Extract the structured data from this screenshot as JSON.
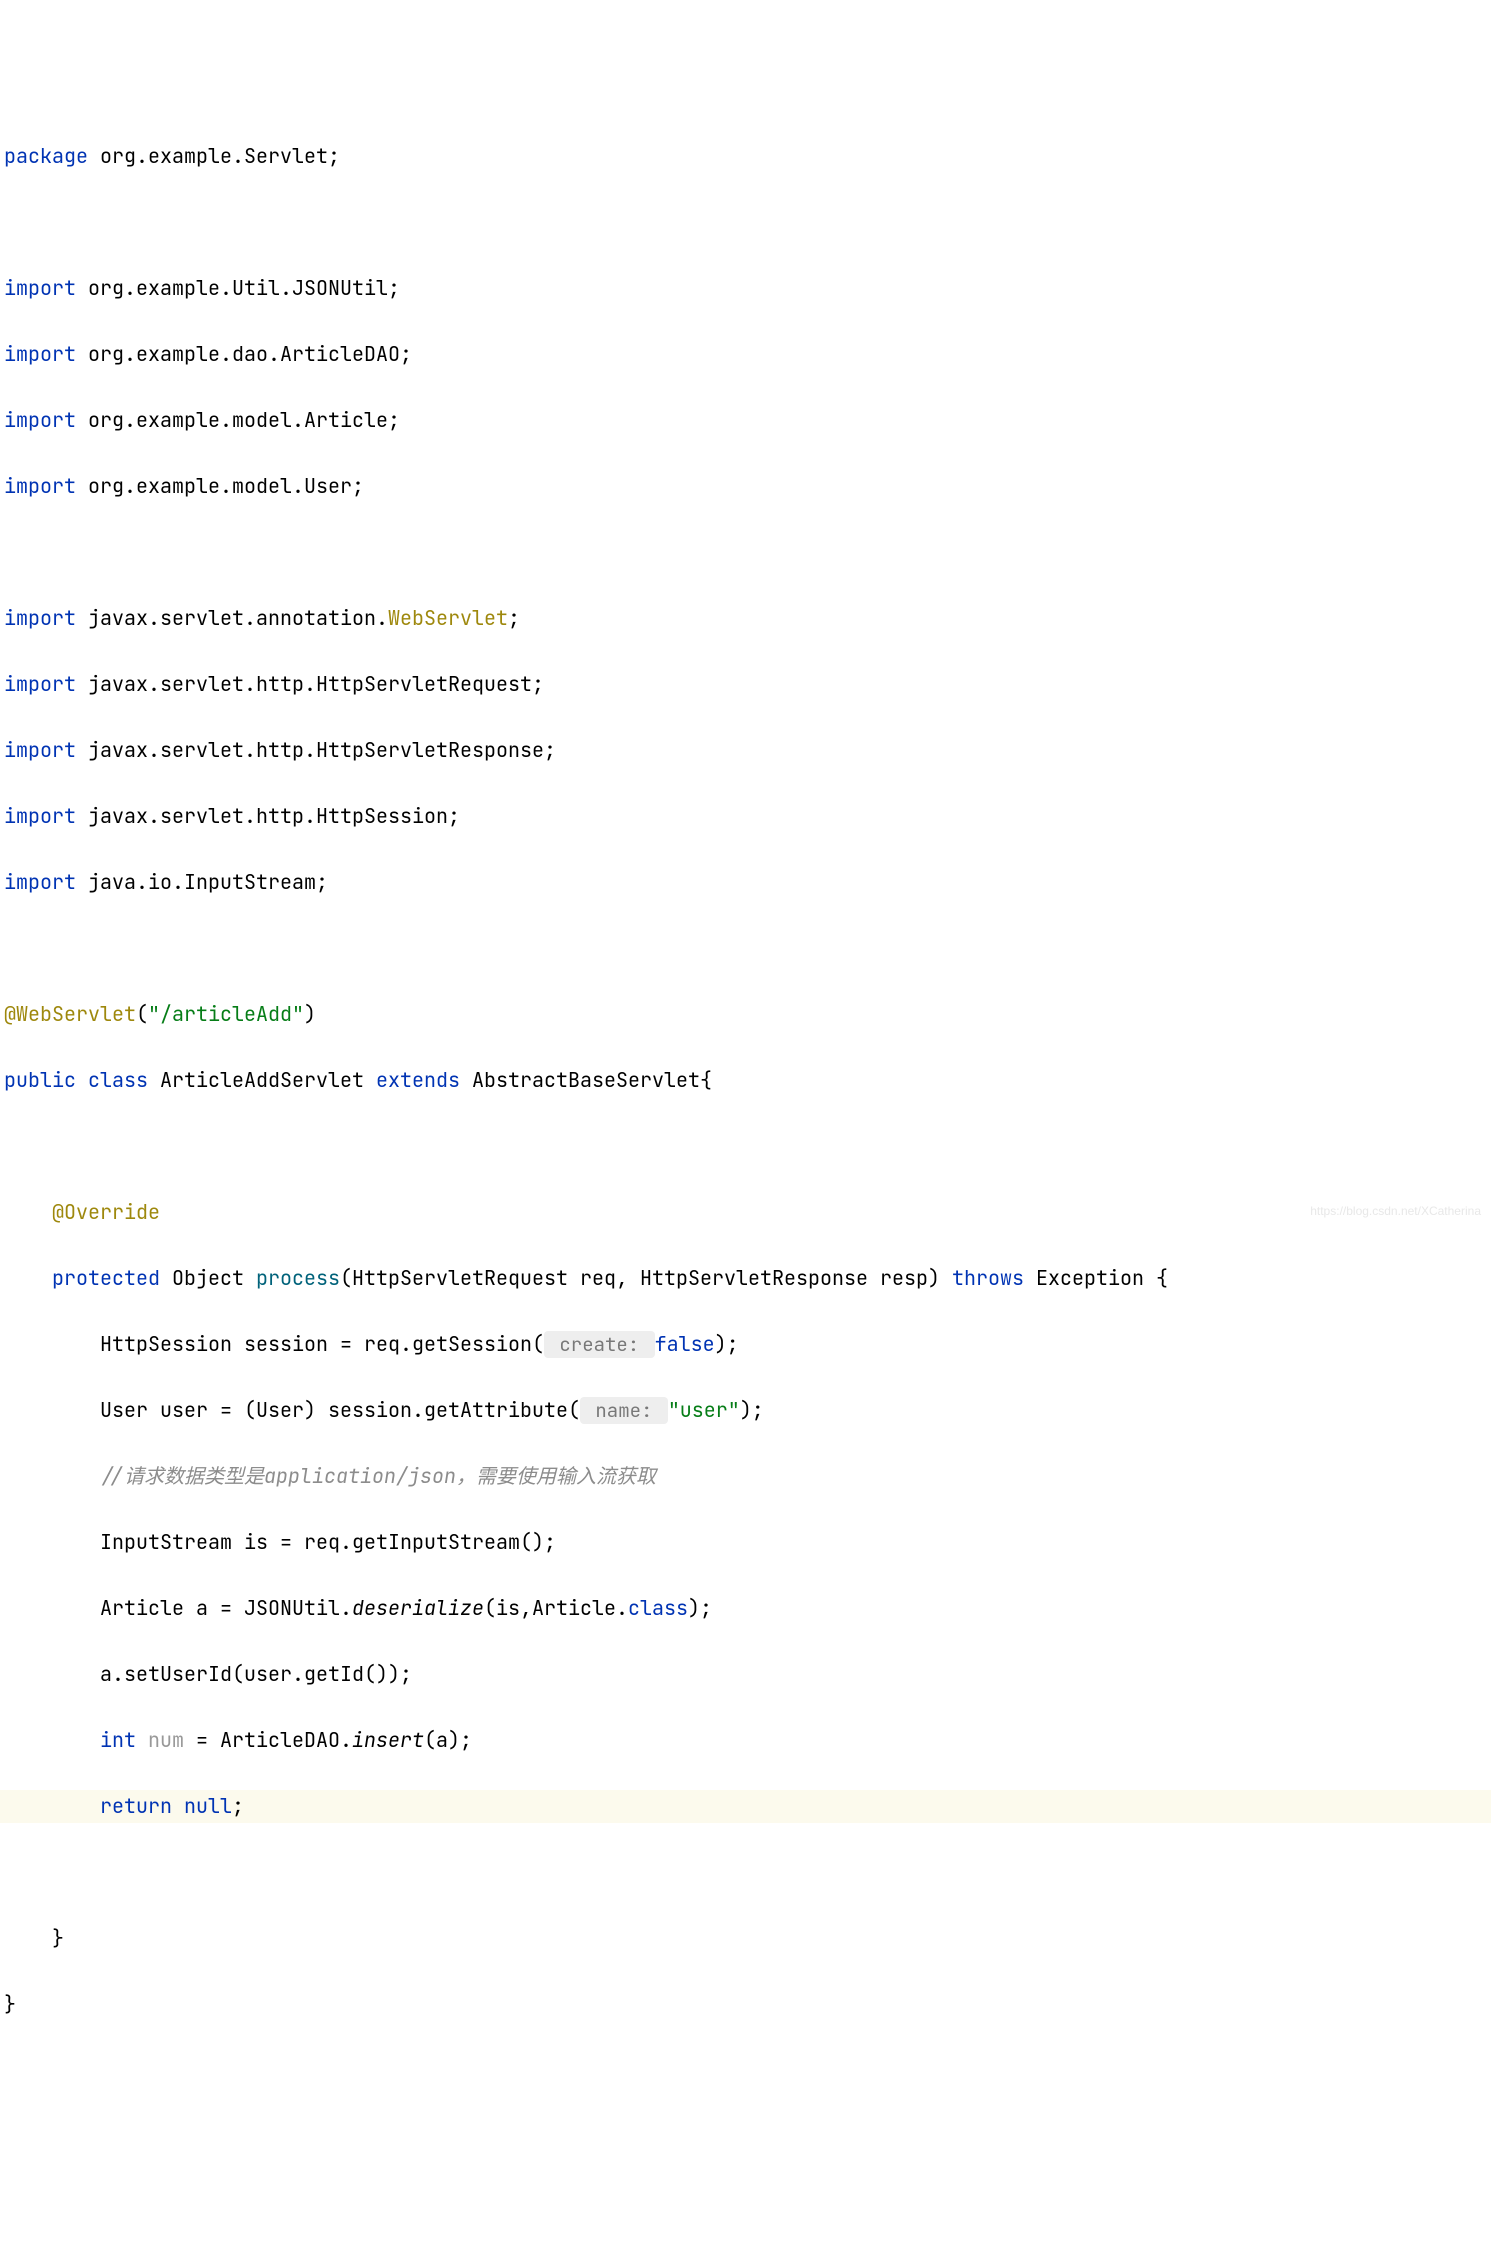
{
  "code": {
    "line1": {
      "kw": "package",
      "rest": " org.example.Servlet;"
    },
    "line3": {
      "kw": "import",
      "rest": " org.example.Util.JSONUtil;"
    },
    "line4": {
      "kw": "import",
      "rest": " org.example.dao.ArticleDAO;"
    },
    "line5": {
      "kw": "import",
      "rest": " org.example.model.Article;"
    },
    "line6": {
      "kw": "import",
      "rest": " org.example.model.User;"
    },
    "line8": {
      "kw": "import",
      "rest1": " javax.servlet.annotation.",
      "ann": "WebServlet",
      "rest2": ";"
    },
    "line9": {
      "kw": "import",
      "rest": " javax.servlet.http.HttpServletRequest;"
    },
    "line10": {
      "kw": "import",
      "rest": " javax.servlet.http.HttpServletResponse;"
    },
    "line11": {
      "kw": "import",
      "rest": " javax.servlet.http.HttpSession;"
    },
    "line12": {
      "kw": "import",
      "rest": " java.io.InputStream;"
    },
    "line14": {
      "ann": "@WebServlet",
      "paren1": "(",
      "str": "\"/articleAdd\"",
      "paren2": ")"
    },
    "line15": {
      "kw1": "public class",
      "name": " ArticleAddServlet ",
      "kw2": "extends",
      "rest": " AbstractBaseServlet{"
    },
    "line17": {
      "ann": "@Override"
    },
    "line18": {
      "indent": "    ",
      "kw": "protected",
      "ret": " Object ",
      "method": "process",
      "sig": "(HttpServletRequest req, HttpServletResponse resp) ",
      "kw2": "throws",
      "rest": " Exception {"
    },
    "line19": {
      "indent": "        ",
      "text1": "HttpSession session = req.getSession(",
      "hint": " create: ",
      "kw": "false",
      "text2": ");"
    },
    "line20": {
      "indent": "        ",
      "text1": "User user = (User) session.getAttribute(",
      "hint": " name: ",
      "str": "\"user\"",
      "text2": ");"
    },
    "line21": {
      "indent": "        ",
      "comment": "//请求数据类型是application/json，需要使用输入流获取"
    },
    "line22": {
      "indent": "        ",
      "text": "InputStream is = req.getInputStream();"
    },
    "line23": {
      "indent": "        ",
      "text1": "Article a = JSONUtil.",
      "italic": "deserialize",
      "text2": "(is,Article.",
      "kw": "class",
      "text3": ");"
    },
    "line24": {
      "indent": "        ",
      "text": "a.setUserId(user.getId());"
    },
    "line25": {
      "indent": "        ",
      "kw": "int",
      "unused": " num",
      "text1": " = ArticleDAO.",
      "italic": "insert",
      "text2": "(a);"
    },
    "line26": {
      "indent": "        ",
      "kw": "return null",
      "text": ";"
    },
    "line28": {
      "indent": "    ",
      "text": "}"
    },
    "line29": {
      "text": "}"
    }
  },
  "watermark": "https://blog.csdn.net/XCatherina"
}
